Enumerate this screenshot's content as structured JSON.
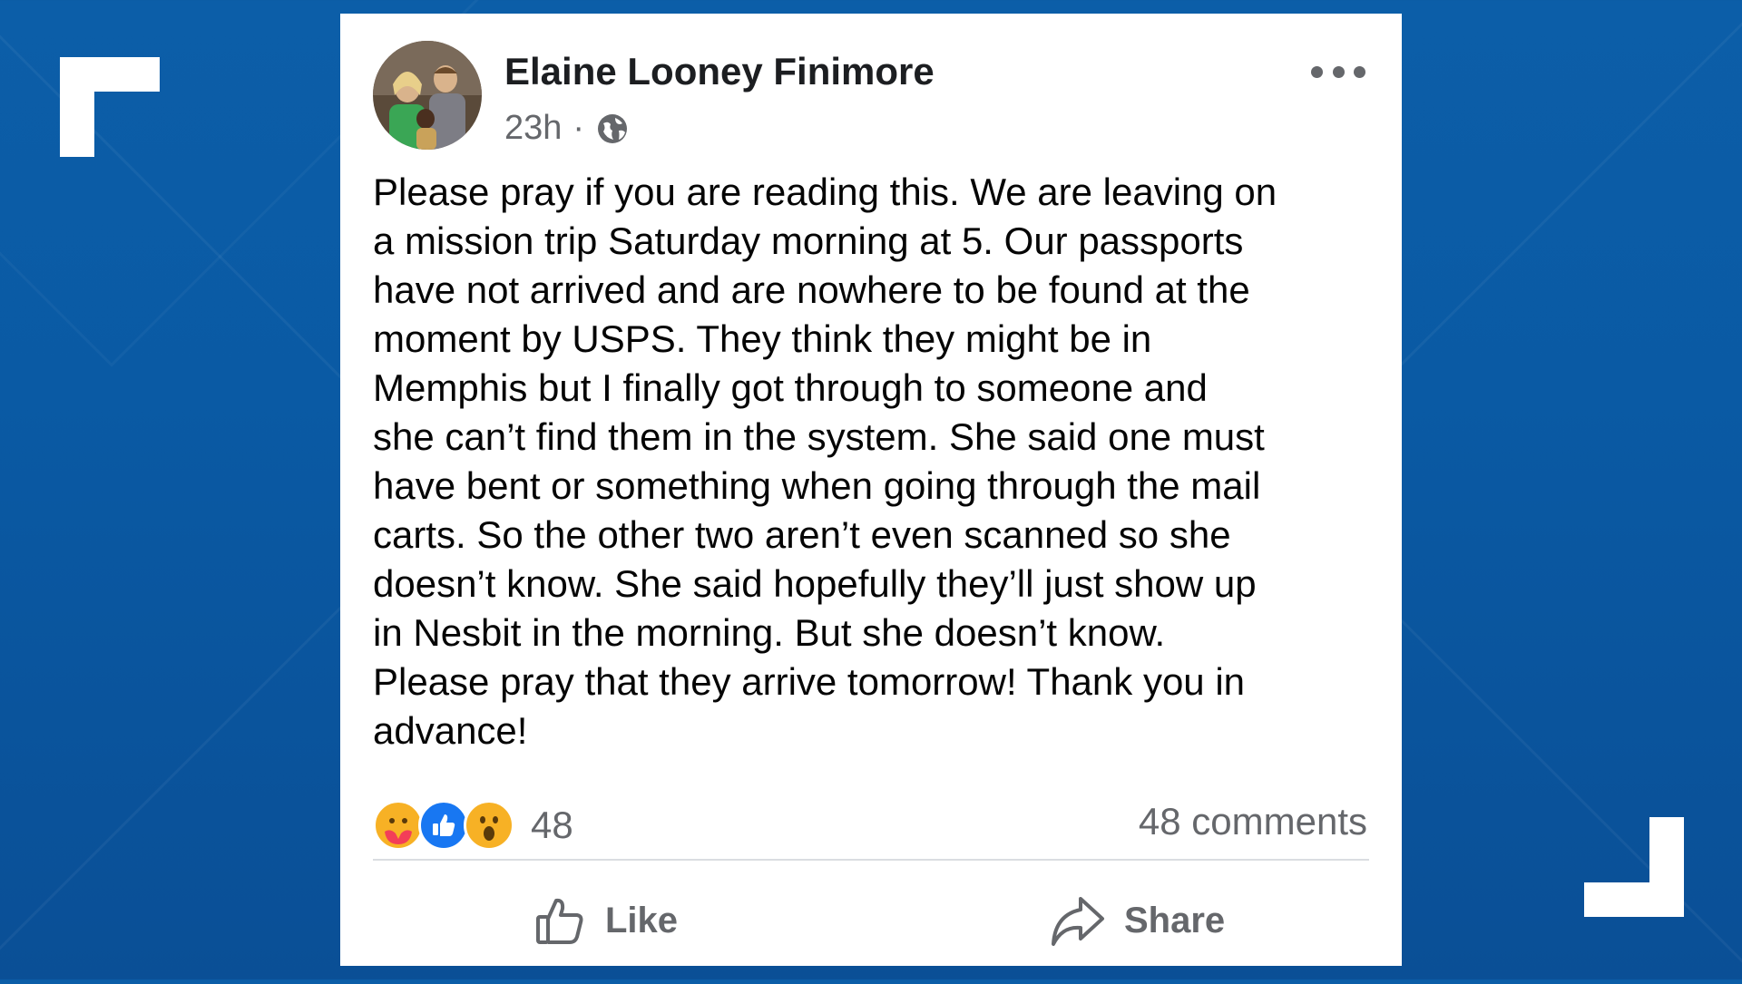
{
  "post": {
    "author": "Elaine Looney Finimore",
    "time": "23h",
    "separator": "·",
    "privacy_icon": "globe-icon",
    "more_icon": "more-options-icon",
    "body": "Please pray if you are reading this. We are leaving on\na mission trip Saturday morning at 5. Our passports\nhave not arrived and are nowhere to be found at the\nmoment by USPS. They think they might be in\nMemphis but I finally got through to someone and\nshe can’t find them in the system. She said one must\nhave bent or something when going through the mail\ncarts. So the other two aren’t even scanned so she\ndoesn’t know. She said hopefully they’ll just show up\nin Nesbit in the morning. But she doesn’t know.\nPlease pray that they arrive tomorrow! Thank you in\nadvance!"
  },
  "reactions": {
    "icons": [
      "care-reaction-icon",
      "like-reaction-icon",
      "wow-reaction-icon"
    ],
    "count": "48",
    "comments": "48 comments"
  },
  "actions": {
    "like_label": "Like",
    "share_label": "Share"
  },
  "colors": {
    "background_blue": "#0a5aa4",
    "card": "#ffffff",
    "text": "#050505",
    "muted": "#65676b",
    "like_blue": "#1877f2",
    "reaction_yellow": "#f7b125"
  }
}
